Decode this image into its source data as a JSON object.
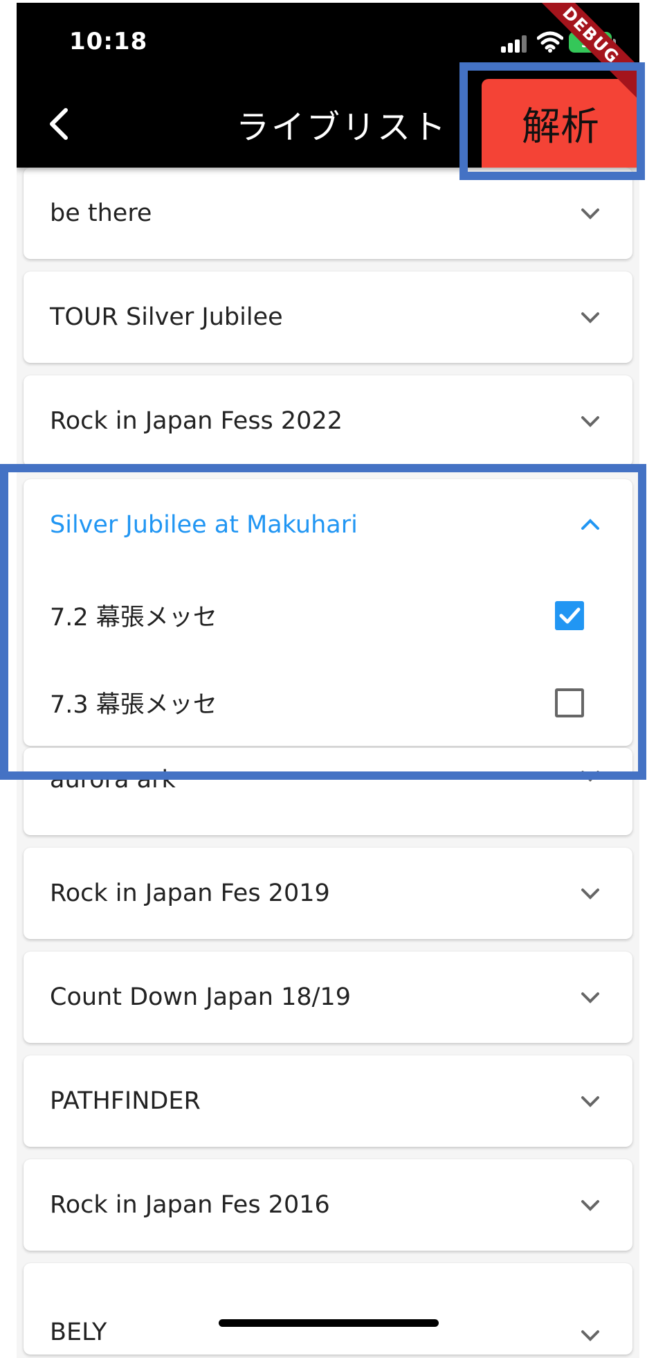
{
  "status_bar": {
    "time": "10:18",
    "battery": "97"
  },
  "app_bar": {
    "title": "ライブリスト",
    "action_label": "解析",
    "debug_banner": "DEBUG"
  },
  "lives": [
    {
      "title": "be there",
      "expanded": false
    },
    {
      "title": "TOUR Silver Jubilee",
      "expanded": false
    },
    {
      "title": "Rock in Japan Fess 2022",
      "expanded": false
    },
    {
      "title": "Silver Jubilee at Makuhari",
      "expanded": true,
      "dates": [
        {
          "label": "7.2 幕張メッセ",
          "checked": true
        },
        {
          "label": "7.3 幕張メッセ",
          "checked": false
        }
      ]
    },
    {
      "title": "aurora ark",
      "expanded": false
    },
    {
      "title": "Rock in Japan Fes 2019",
      "expanded": false
    },
    {
      "title": "Count Down Japan 18/19",
      "expanded": false
    },
    {
      "title": "PATHFINDER",
      "expanded": false
    },
    {
      "title": "Rock in Japan Fes 2016",
      "expanded": false
    },
    {
      "title": "BELY",
      "expanded": false
    }
  ],
  "colors": {
    "accent": "#2196f3",
    "action_button": "#f44336",
    "highlight_box": "#4472c4",
    "app_bar": "#000000"
  }
}
